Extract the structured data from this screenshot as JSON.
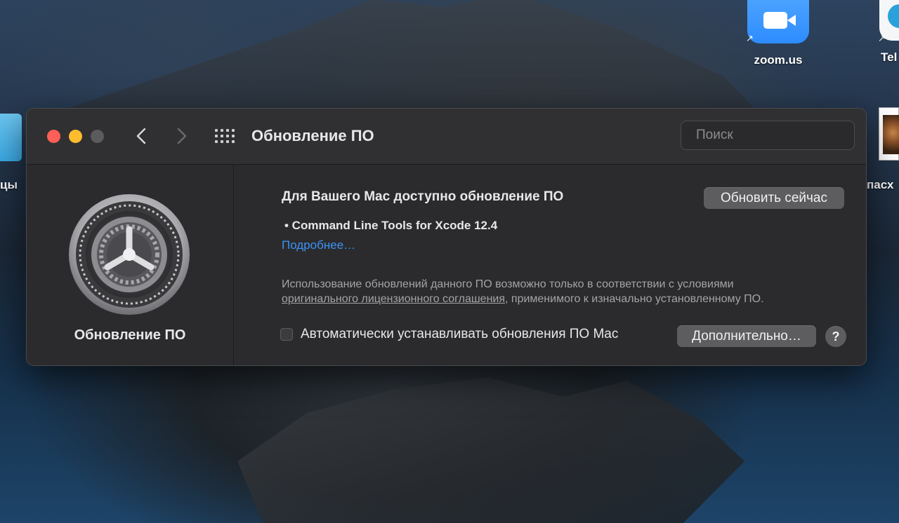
{
  "desktop": {
    "icons": {
      "zoom_label": "zoom.us",
      "telegram_label": "Tel",
      "left_folder_label": "цы",
      "right_file_label": "пасх"
    }
  },
  "window": {
    "title": "Обновление ПО",
    "search": {
      "placeholder": "Поиск",
      "value": ""
    },
    "sidebar": {
      "label": "Обновление ПО"
    },
    "content": {
      "heading": "Для Вашего Mac доступно обновление ПО",
      "update_now_label": "Обновить сейчас",
      "update_item": "• Command Line Tools for Xcode 12.4",
      "more_link": "Подробнее…",
      "license_prefix": "Использование обновлений данного ПО возможно только в соответствии с условиями",
      "license_link": "оригинального лицензионного соглашения",
      "license_suffix": ", применимого к изначально установленному ПО.",
      "auto_update_label": "Автоматически устанавливать обновления ПО Mac",
      "auto_update_checked": false,
      "advanced_label": "Дополнительно…",
      "help_label": "?"
    }
  },
  "colors": {
    "close": "#ff5f57",
    "minimize": "#febc2e",
    "link": "#3b93f5"
  }
}
